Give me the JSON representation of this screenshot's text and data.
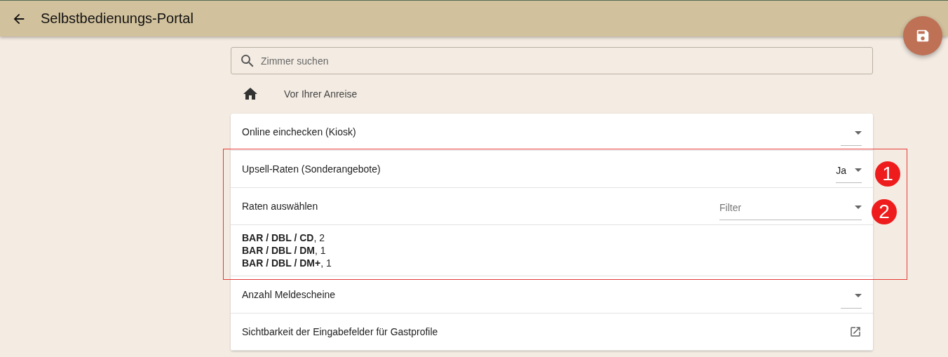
{
  "header": {
    "title": "Selbstbedienungs-Portal"
  },
  "search": {
    "placeholder": "Zimmer suchen"
  },
  "breadcrumb": {
    "label": "Vor Ihrer Anreise"
  },
  "settings": [
    {
      "kind": "select",
      "label": "Online einchecken (Kiosk)"
    },
    {
      "kind": "select",
      "label": "Upsell-Raten (Sonderangebote)",
      "value": "Ja"
    },
    {
      "kind": "filter",
      "label": "Raten auswählen",
      "placeholder": "Filter"
    },
    {
      "kind": "list",
      "items": [
        "**BAR / DBL / CD**, 2",
        "**BAR / DBL / DM**, 1",
        "**BAR / DBL / DM+**, 1"
      ]
    },
    {
      "kind": "select",
      "label": "Anzahl Meldescheine"
    },
    {
      "kind": "link",
      "label": "Sichtbarkeit der Eingabefelder für Gastprofile"
    }
  ],
  "annotations": [
    {
      "number": "1"
    },
    {
      "number": "2"
    }
  ]
}
